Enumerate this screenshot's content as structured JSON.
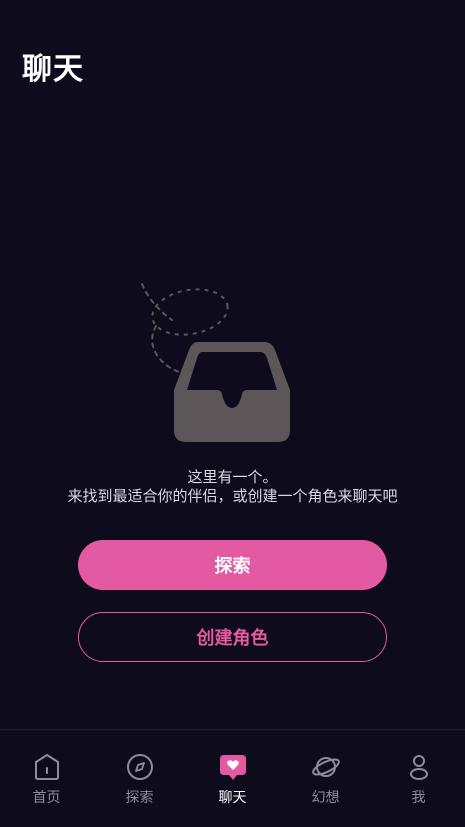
{
  "header": {
    "title": "聊天"
  },
  "empty_state": {
    "line1": "这里有一个。",
    "line2": "来找到最适合你的伴侣，或创建一个角色来聊天吧"
  },
  "buttons": {
    "explore_label": "探索",
    "create_label": "创建角色"
  },
  "tabbar": {
    "items": [
      {
        "label": "首页",
        "icon": "home-icon"
      },
      {
        "label": "探索",
        "icon": "compass-icon"
      },
      {
        "label": "聊天",
        "icon": "chat-heart-icon",
        "active": true
      },
      {
        "label": "幻想",
        "icon": "planet-icon"
      },
      {
        "label": "我",
        "icon": "person-icon"
      }
    ]
  },
  "colors": {
    "background": "#0d0b1c",
    "accent": "#e35aa2",
    "inactive": "#8e8c9c",
    "illustration": "#5c5658"
  }
}
